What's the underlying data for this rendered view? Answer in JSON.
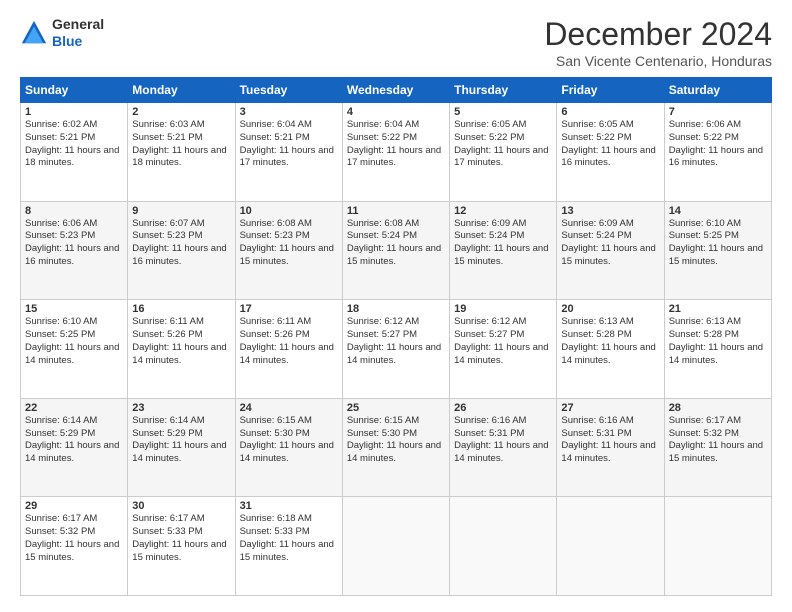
{
  "logo": {
    "general": "General",
    "blue": "Blue"
  },
  "title": "December 2024",
  "subtitle": "San Vicente Centenario, Honduras",
  "weekdays": [
    "Sunday",
    "Monday",
    "Tuesday",
    "Wednesday",
    "Thursday",
    "Friday",
    "Saturday"
  ],
  "weeks": [
    [
      {
        "day": "1",
        "sunrise": "6:02 AM",
        "sunset": "5:21 PM",
        "daylight": "11 hours and 18 minutes."
      },
      {
        "day": "2",
        "sunrise": "6:03 AM",
        "sunset": "5:21 PM",
        "daylight": "11 hours and 18 minutes."
      },
      {
        "day": "3",
        "sunrise": "6:04 AM",
        "sunset": "5:21 PM",
        "daylight": "11 hours and 17 minutes."
      },
      {
        "day": "4",
        "sunrise": "6:04 AM",
        "sunset": "5:22 PM",
        "daylight": "11 hours and 17 minutes."
      },
      {
        "day": "5",
        "sunrise": "6:05 AM",
        "sunset": "5:22 PM",
        "daylight": "11 hours and 17 minutes."
      },
      {
        "day": "6",
        "sunrise": "6:05 AM",
        "sunset": "5:22 PM",
        "daylight": "11 hours and 16 minutes."
      },
      {
        "day": "7",
        "sunrise": "6:06 AM",
        "sunset": "5:22 PM",
        "daylight": "11 hours and 16 minutes."
      }
    ],
    [
      {
        "day": "8",
        "sunrise": "6:06 AM",
        "sunset": "5:23 PM",
        "daylight": "11 hours and 16 minutes."
      },
      {
        "day": "9",
        "sunrise": "6:07 AM",
        "sunset": "5:23 PM",
        "daylight": "11 hours and 16 minutes."
      },
      {
        "day": "10",
        "sunrise": "6:08 AM",
        "sunset": "5:23 PM",
        "daylight": "11 hours and 15 minutes."
      },
      {
        "day": "11",
        "sunrise": "6:08 AM",
        "sunset": "5:24 PM",
        "daylight": "11 hours and 15 minutes."
      },
      {
        "day": "12",
        "sunrise": "6:09 AM",
        "sunset": "5:24 PM",
        "daylight": "11 hours and 15 minutes."
      },
      {
        "day": "13",
        "sunrise": "6:09 AM",
        "sunset": "5:24 PM",
        "daylight": "11 hours and 15 minutes."
      },
      {
        "day": "14",
        "sunrise": "6:10 AM",
        "sunset": "5:25 PM",
        "daylight": "11 hours and 15 minutes."
      }
    ],
    [
      {
        "day": "15",
        "sunrise": "6:10 AM",
        "sunset": "5:25 PM",
        "daylight": "11 hours and 14 minutes."
      },
      {
        "day": "16",
        "sunrise": "6:11 AM",
        "sunset": "5:26 PM",
        "daylight": "11 hours and 14 minutes."
      },
      {
        "day": "17",
        "sunrise": "6:11 AM",
        "sunset": "5:26 PM",
        "daylight": "11 hours and 14 minutes."
      },
      {
        "day": "18",
        "sunrise": "6:12 AM",
        "sunset": "5:27 PM",
        "daylight": "11 hours and 14 minutes."
      },
      {
        "day": "19",
        "sunrise": "6:12 AM",
        "sunset": "5:27 PM",
        "daylight": "11 hours and 14 minutes."
      },
      {
        "day": "20",
        "sunrise": "6:13 AM",
        "sunset": "5:28 PM",
        "daylight": "11 hours and 14 minutes."
      },
      {
        "day": "21",
        "sunrise": "6:13 AM",
        "sunset": "5:28 PM",
        "daylight": "11 hours and 14 minutes."
      }
    ],
    [
      {
        "day": "22",
        "sunrise": "6:14 AM",
        "sunset": "5:29 PM",
        "daylight": "11 hours and 14 minutes."
      },
      {
        "day": "23",
        "sunrise": "6:14 AM",
        "sunset": "5:29 PM",
        "daylight": "11 hours and 14 minutes."
      },
      {
        "day": "24",
        "sunrise": "6:15 AM",
        "sunset": "5:30 PM",
        "daylight": "11 hours and 14 minutes."
      },
      {
        "day": "25",
        "sunrise": "6:15 AM",
        "sunset": "5:30 PM",
        "daylight": "11 hours and 14 minutes."
      },
      {
        "day": "26",
        "sunrise": "6:16 AM",
        "sunset": "5:31 PM",
        "daylight": "11 hours and 14 minutes."
      },
      {
        "day": "27",
        "sunrise": "6:16 AM",
        "sunset": "5:31 PM",
        "daylight": "11 hours and 14 minutes."
      },
      {
        "day": "28",
        "sunrise": "6:17 AM",
        "sunset": "5:32 PM",
        "daylight": "11 hours and 15 minutes."
      }
    ],
    [
      {
        "day": "29",
        "sunrise": "6:17 AM",
        "sunset": "5:32 PM",
        "daylight": "11 hours and 15 minutes."
      },
      {
        "day": "30",
        "sunrise": "6:17 AM",
        "sunset": "5:33 PM",
        "daylight": "11 hours and 15 minutes."
      },
      {
        "day": "31",
        "sunrise": "6:18 AM",
        "sunset": "5:33 PM",
        "daylight": "11 hours and 15 minutes."
      },
      null,
      null,
      null,
      null
    ]
  ]
}
